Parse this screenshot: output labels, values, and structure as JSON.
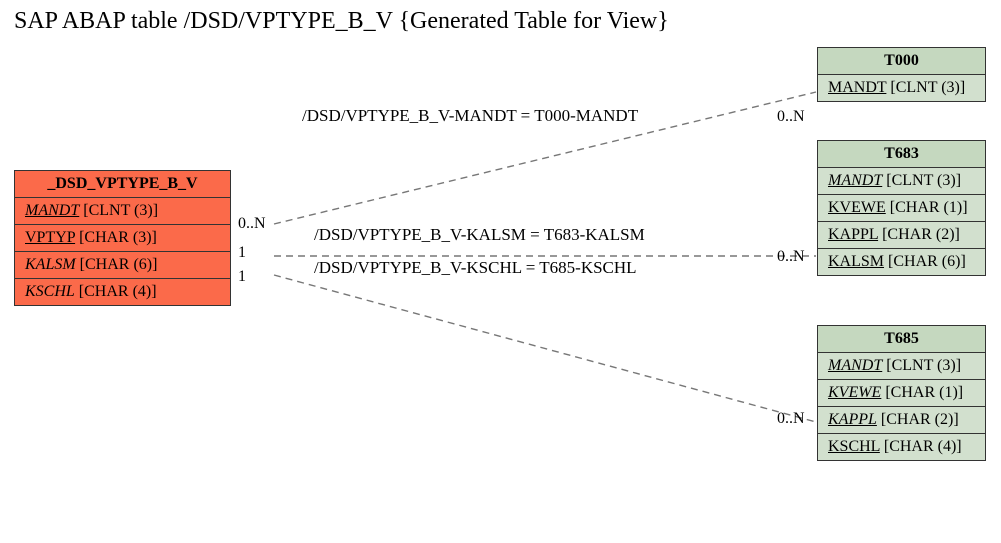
{
  "title": "SAP ABAP table /DSD/VPTYPE_B_V {Generated Table for View}",
  "source": {
    "name": "_DSD_VPTYPE_B_V",
    "fields": [
      {
        "name": "MANDT",
        "type": "[CLNT (3)]",
        "underline": true,
        "italic": true
      },
      {
        "name": "VPTYP",
        "type": "[CHAR (3)]",
        "underline": true,
        "italic": false
      },
      {
        "name": "KALSM",
        "type": "[CHAR (6)]",
        "underline": false,
        "italic": true
      },
      {
        "name": "KSCHL",
        "type": "[CHAR (4)]",
        "underline": false,
        "italic": true
      }
    ]
  },
  "targets": [
    {
      "name": "T000",
      "fields": [
        {
          "name": "MANDT",
          "type": "[CLNT (3)]",
          "underline": true,
          "italic": false
        }
      ]
    },
    {
      "name": "T683",
      "fields": [
        {
          "name": "MANDT",
          "type": "[CLNT (3)]",
          "underline": true,
          "italic": true
        },
        {
          "name": "KVEWE",
          "type": "[CHAR (1)]",
          "underline": true,
          "italic": false
        },
        {
          "name": "KAPPL",
          "type": "[CHAR (2)]",
          "underline": true,
          "italic": false
        },
        {
          "name": "KALSM",
          "type": "[CHAR (6)]",
          "underline": true,
          "italic": false
        }
      ]
    },
    {
      "name": "T685",
      "fields": [
        {
          "name": "MANDT",
          "type": "[CLNT (3)]",
          "underline": true,
          "italic": true
        },
        {
          "name": "KVEWE",
          "type": "[CHAR (1)]",
          "underline": true,
          "italic": true
        },
        {
          "name": "KAPPL",
          "type": "[CHAR (2)]",
          "underline": true,
          "italic": true
        },
        {
          "name": "KSCHL",
          "type": "[CHAR (4)]",
          "underline": true,
          "italic": false
        }
      ]
    }
  ],
  "relations": [
    {
      "label": "/DSD/VPTYPE_B_V-MANDT = T000-MANDT",
      "src_card": "0..N",
      "tgt_card": "0..N"
    },
    {
      "label": "/DSD/VPTYPE_B_V-KALSM = T683-KALSM",
      "src_card": "1",
      "tgt_card": "0..N"
    },
    {
      "label": "/DSD/VPTYPE_B_V-KSCHL = T685-KSCHL",
      "src_card": "1",
      "tgt_card": "0..N"
    }
  ]
}
